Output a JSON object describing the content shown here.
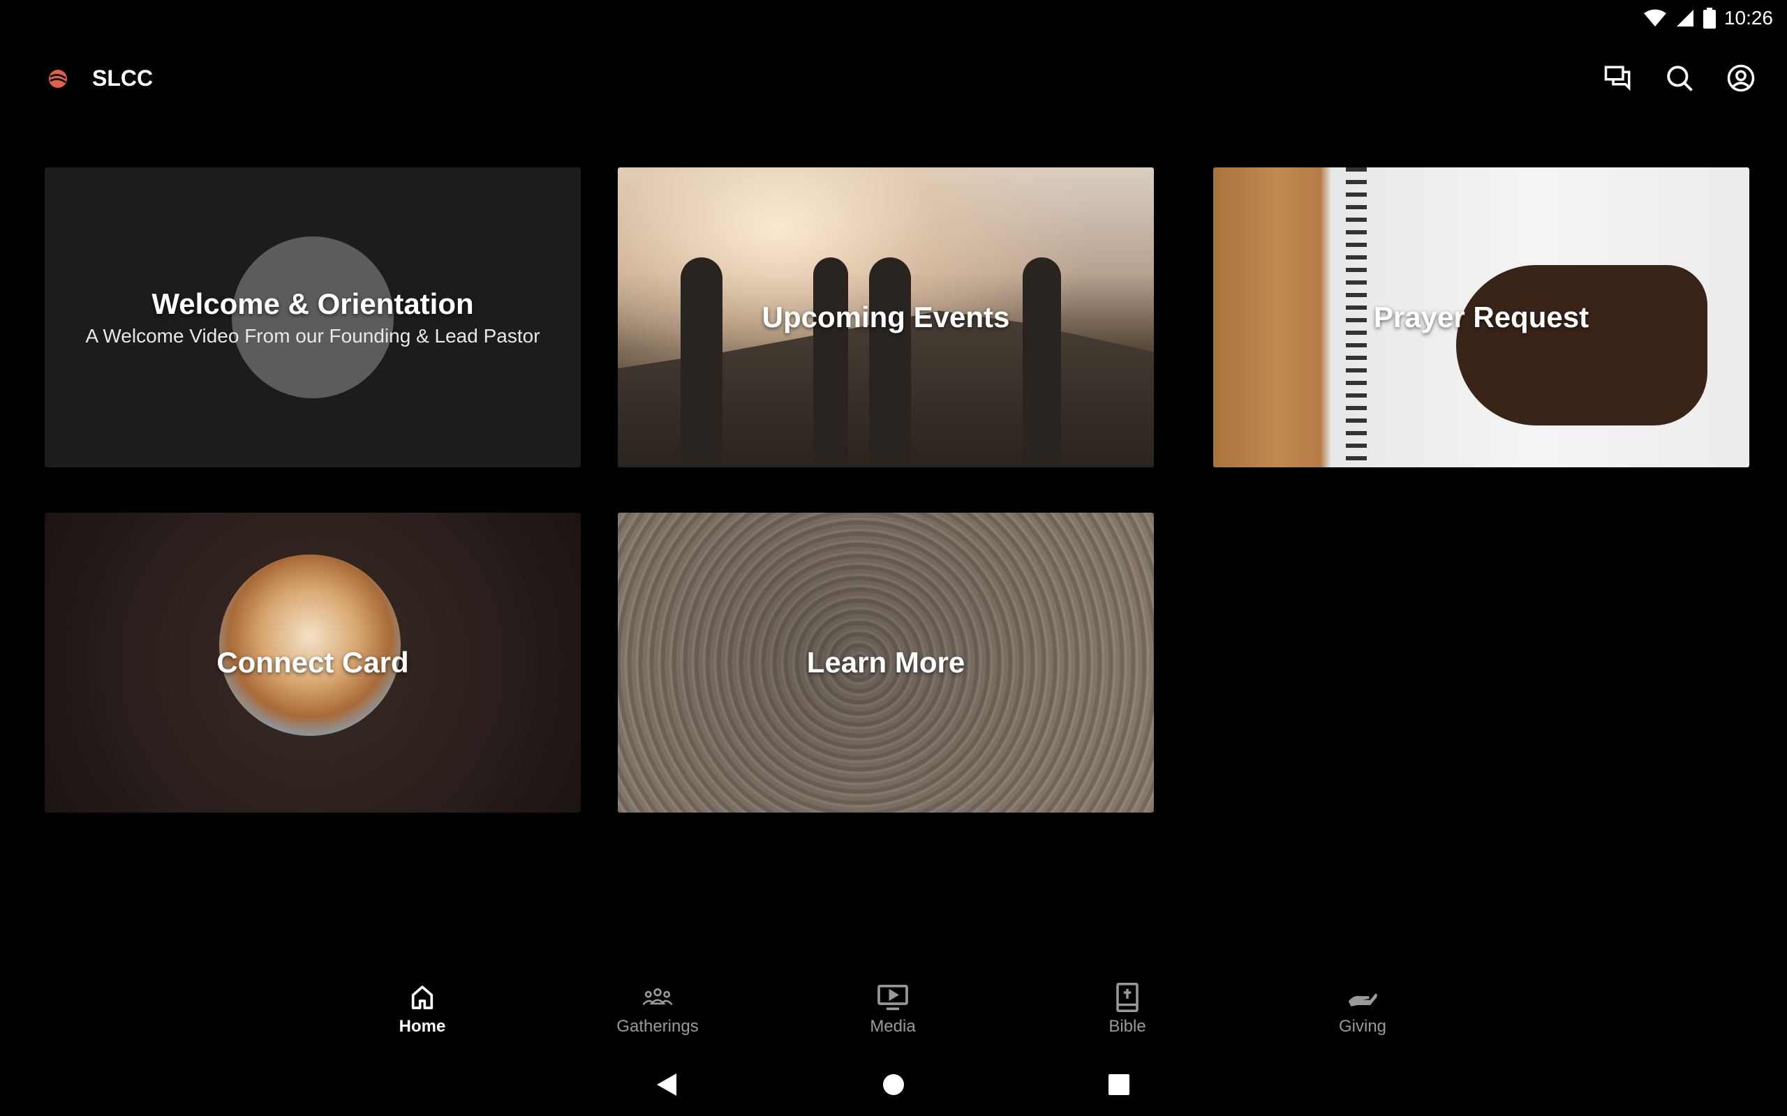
{
  "status_bar": {
    "time": "10:26"
  },
  "app_bar": {
    "title": "SLCC",
    "actions": [
      "chat-icon",
      "search-icon",
      "account-icon"
    ]
  },
  "cards": [
    {
      "title": "Welcome & Orientation",
      "subtitle": "A Welcome Video From our Founding & Lead Pastor"
    },
    {
      "title": "Upcoming Events"
    },
    {
      "title": "Prayer Request"
    },
    {
      "title": "Connect Card"
    },
    {
      "title": "Learn More"
    }
  ],
  "bottom_nav": {
    "items": [
      {
        "label": "Home",
        "icon": "home-icon",
        "active": true
      },
      {
        "label": "Gatherings",
        "icon": "people-icon"
      },
      {
        "label": "Media",
        "icon": "video-icon"
      },
      {
        "label": "Bible",
        "icon": "bible-icon"
      },
      {
        "label": "Giving",
        "icon": "giving-hand-icon"
      }
    ]
  },
  "colors": {
    "background": "#000000",
    "card_bg": "#1c1c1c",
    "nav_inactive": "#9a9a9a",
    "logo_accent": "#e0604a"
  }
}
